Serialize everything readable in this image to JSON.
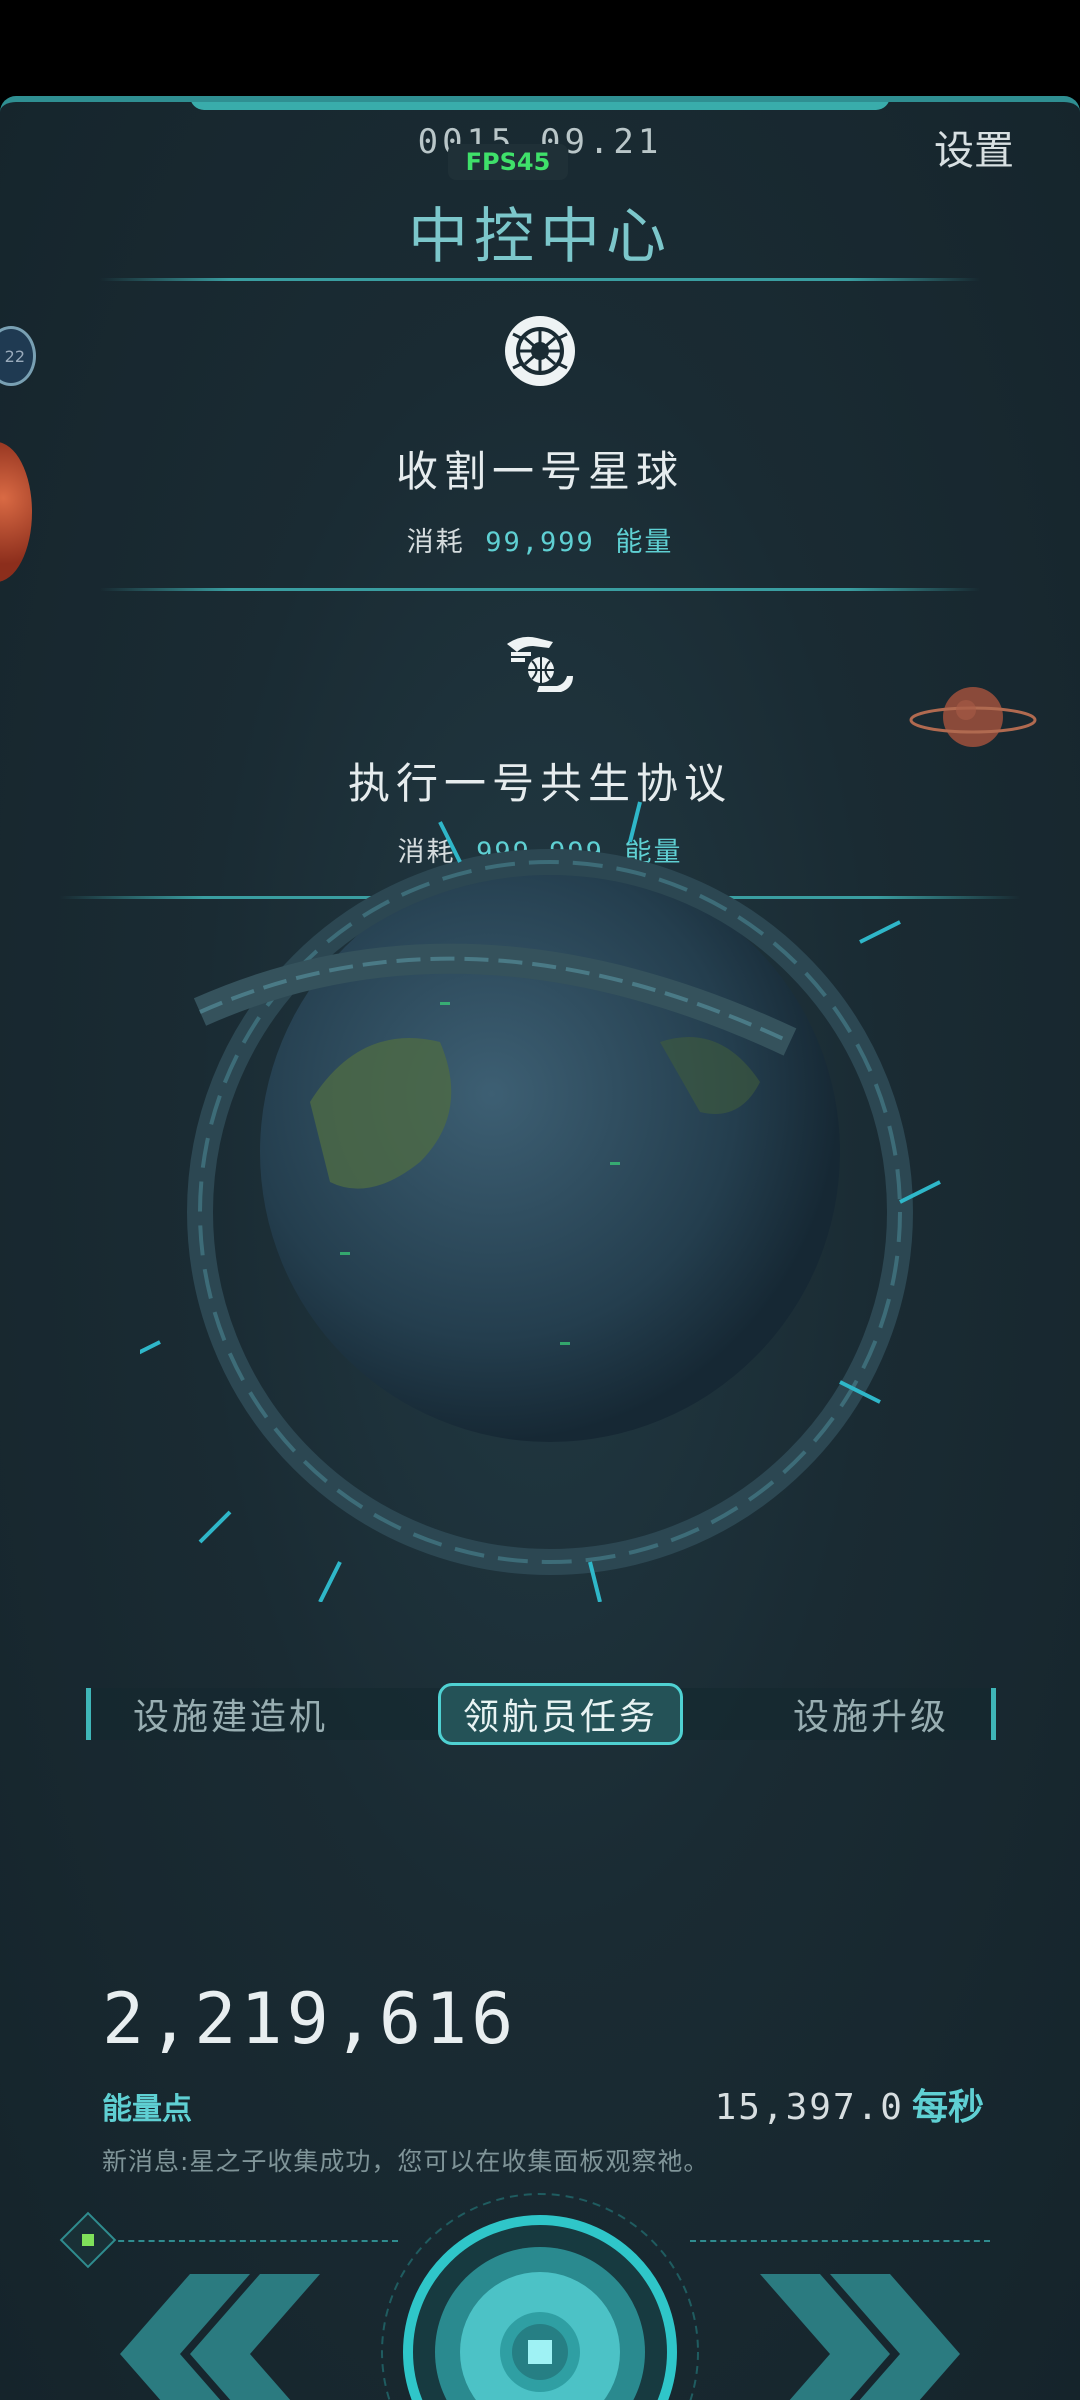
{
  "header": {
    "date": "0015.09.21",
    "fps": "FPS45",
    "settings_label": "设置",
    "title": "中控中心"
  },
  "side": {
    "badge_text": "22"
  },
  "tasks": [
    {
      "icon": "globe-target-icon",
      "title": "收割一号星球",
      "cost_label": "消耗",
      "cost_value": "99,999",
      "cost_unit": "能量"
    },
    {
      "icon": "hand-globe-icon",
      "title": "执行一号共生协议",
      "cost_label": "消耗",
      "cost_value": "999,999",
      "cost_unit": "能量"
    }
  ],
  "tabs": [
    {
      "label": "设施建造机",
      "active": false
    },
    {
      "label": "领航员任务",
      "active": true
    },
    {
      "label": "设施升级",
      "active": false
    }
  ],
  "energy": {
    "value": "2,219,616",
    "label": "能量点",
    "rate_value": "15,397.0",
    "rate_unit": "每秒"
  },
  "news": "新消息:星之子收集成功，您可以在收集面板观察祂。",
  "colors": {
    "accent": "#5fd0d3",
    "fps": "#3fe06a",
    "background": "#1a2b33"
  }
}
